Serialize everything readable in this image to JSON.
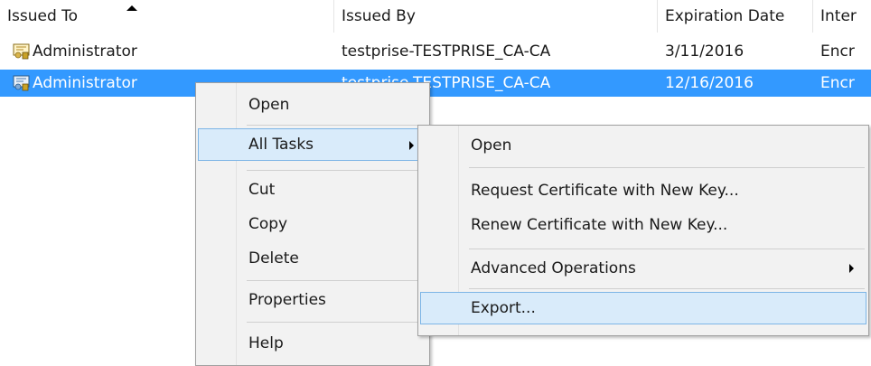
{
  "columns": [
    {
      "label": "Issued To"
    },
    {
      "label": "Issued By"
    },
    {
      "label": "Expiration Date"
    },
    {
      "label": "Inter"
    }
  ],
  "rows": [
    {
      "issued_to": "Administrator",
      "issued_by": "testprise-TESTPRISE_CA-CA",
      "expiration": "3/11/2016",
      "intended": "Encr"
    },
    {
      "issued_to": "Administrator",
      "issued_by": "testprise-TESTPRISE_CA-CA",
      "expiration": "12/16/2016",
      "intended": "Encr"
    }
  ],
  "context_menu": {
    "items": [
      "Open",
      "All Tasks",
      "Cut",
      "Copy",
      "Delete",
      "Properties",
      "Help"
    ]
  },
  "submenu": {
    "items": [
      "Open",
      "Request Certificate with New Key...",
      "Renew Certificate with New Key...",
      "Advanced Operations",
      "Export..."
    ]
  },
  "colors": {
    "selection": "#3399ff",
    "menu_background": "#f2f2f2",
    "menu_highlight": "#d9ebfa",
    "menu_highlight_border": "#7db5e6"
  }
}
